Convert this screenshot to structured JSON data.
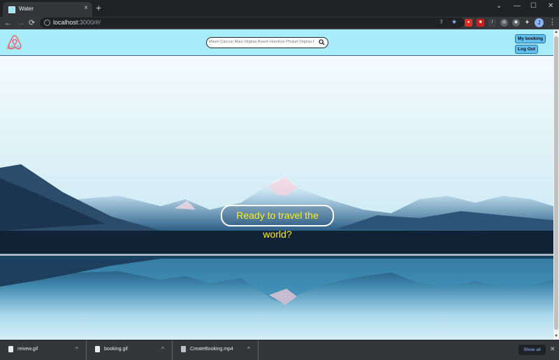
{
  "browser": {
    "tab_title": "Water",
    "tab_close": "×",
    "new_tab": "+",
    "url_host": "localhost",
    "url_rest": ":3000/#/",
    "nav": {
      "back": "←",
      "forward": "→",
      "reload": "⟳"
    },
    "window": {
      "chevron": "⌄",
      "minimize": "—",
      "maximize": "☐",
      "close": "✕"
    },
    "profile_initial": "J",
    "menu": "⋮"
  },
  "site": {
    "logo_text": "airbnb",
    "brand_color": "#ff5a5f",
    "search_text": "Miami Cancun Maui Virginia Beach Honolulu Phuket Virginia Beach Key West",
    "my_booking_label": "My booking",
    "logout_label": "Log Out",
    "headline": "Ready to travel the world?",
    "headline_color": "#ffef26",
    "navbar_color": "#a8ecfb"
  },
  "downloads": {
    "items": [
      {
        "name": "reivew.gif",
        "caret": "^"
      },
      {
        "name": "booking.gif",
        "caret": "^"
      },
      {
        "name": "CreateBooking.mp4",
        "caret": "^"
      }
    ],
    "show_all": "Show all",
    "close": "✕"
  }
}
